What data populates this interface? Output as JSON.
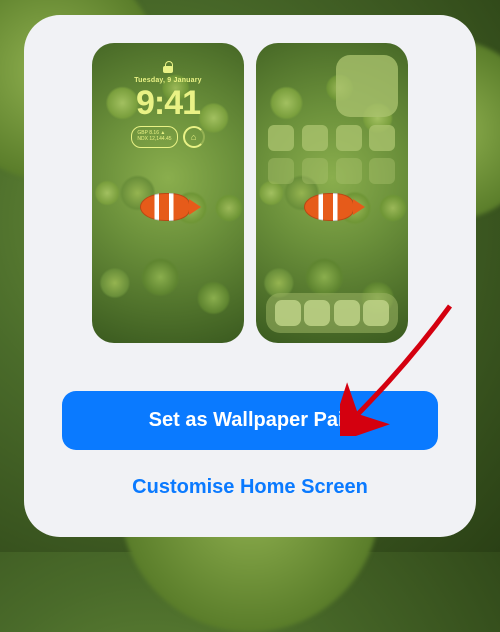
{
  "lockscreen": {
    "date": "Tuesday, 9 January",
    "time": "9:41",
    "widget_stock_1": "GBP 8.16 ▲",
    "widget_stock_2": "NDX 12,144.45",
    "widget_circle": "⌂"
  },
  "buttons": {
    "primary": "Set as Wallpaper Pair",
    "secondary": "Customise Home Screen"
  }
}
